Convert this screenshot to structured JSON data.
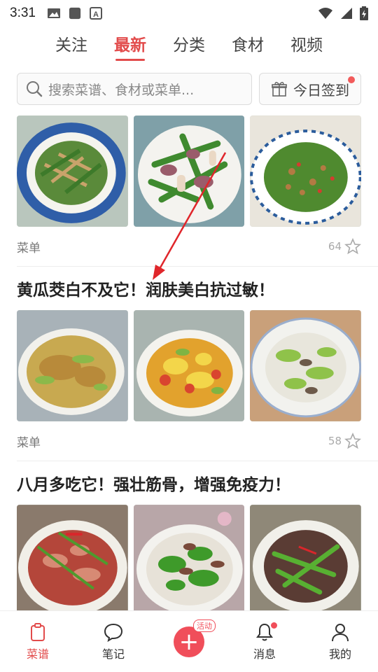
{
  "status_bar": {
    "time": "3:31"
  },
  "tabs": [
    {
      "label": "关注",
      "active": false
    },
    {
      "label": "最新",
      "active": true
    },
    {
      "label": "分类",
      "active": false
    },
    {
      "label": "食材",
      "active": false
    },
    {
      "label": "视频",
      "active": false
    }
  ],
  "search": {
    "placeholder": "搜索菜谱、食材或菜单..."
  },
  "checkin": {
    "label": "今日签到"
  },
  "cards": [
    {
      "title": "",
      "tag": "菜单",
      "likes": "64"
    },
    {
      "title": "黄瓜茭白不及它！润肤美白抗过敏！",
      "tag": "菜单",
      "likes": "58"
    },
    {
      "title": "八月多吃它！强壮筋骨，增强免疫力！"
    }
  ],
  "bottom_nav": {
    "recipes": "菜谱",
    "notes": "笔记",
    "activity_badge": "活动",
    "messages": "消息",
    "mine": "我的"
  },
  "colors": {
    "accent": "#e24b4b",
    "plus": "#f04e5a"
  }
}
